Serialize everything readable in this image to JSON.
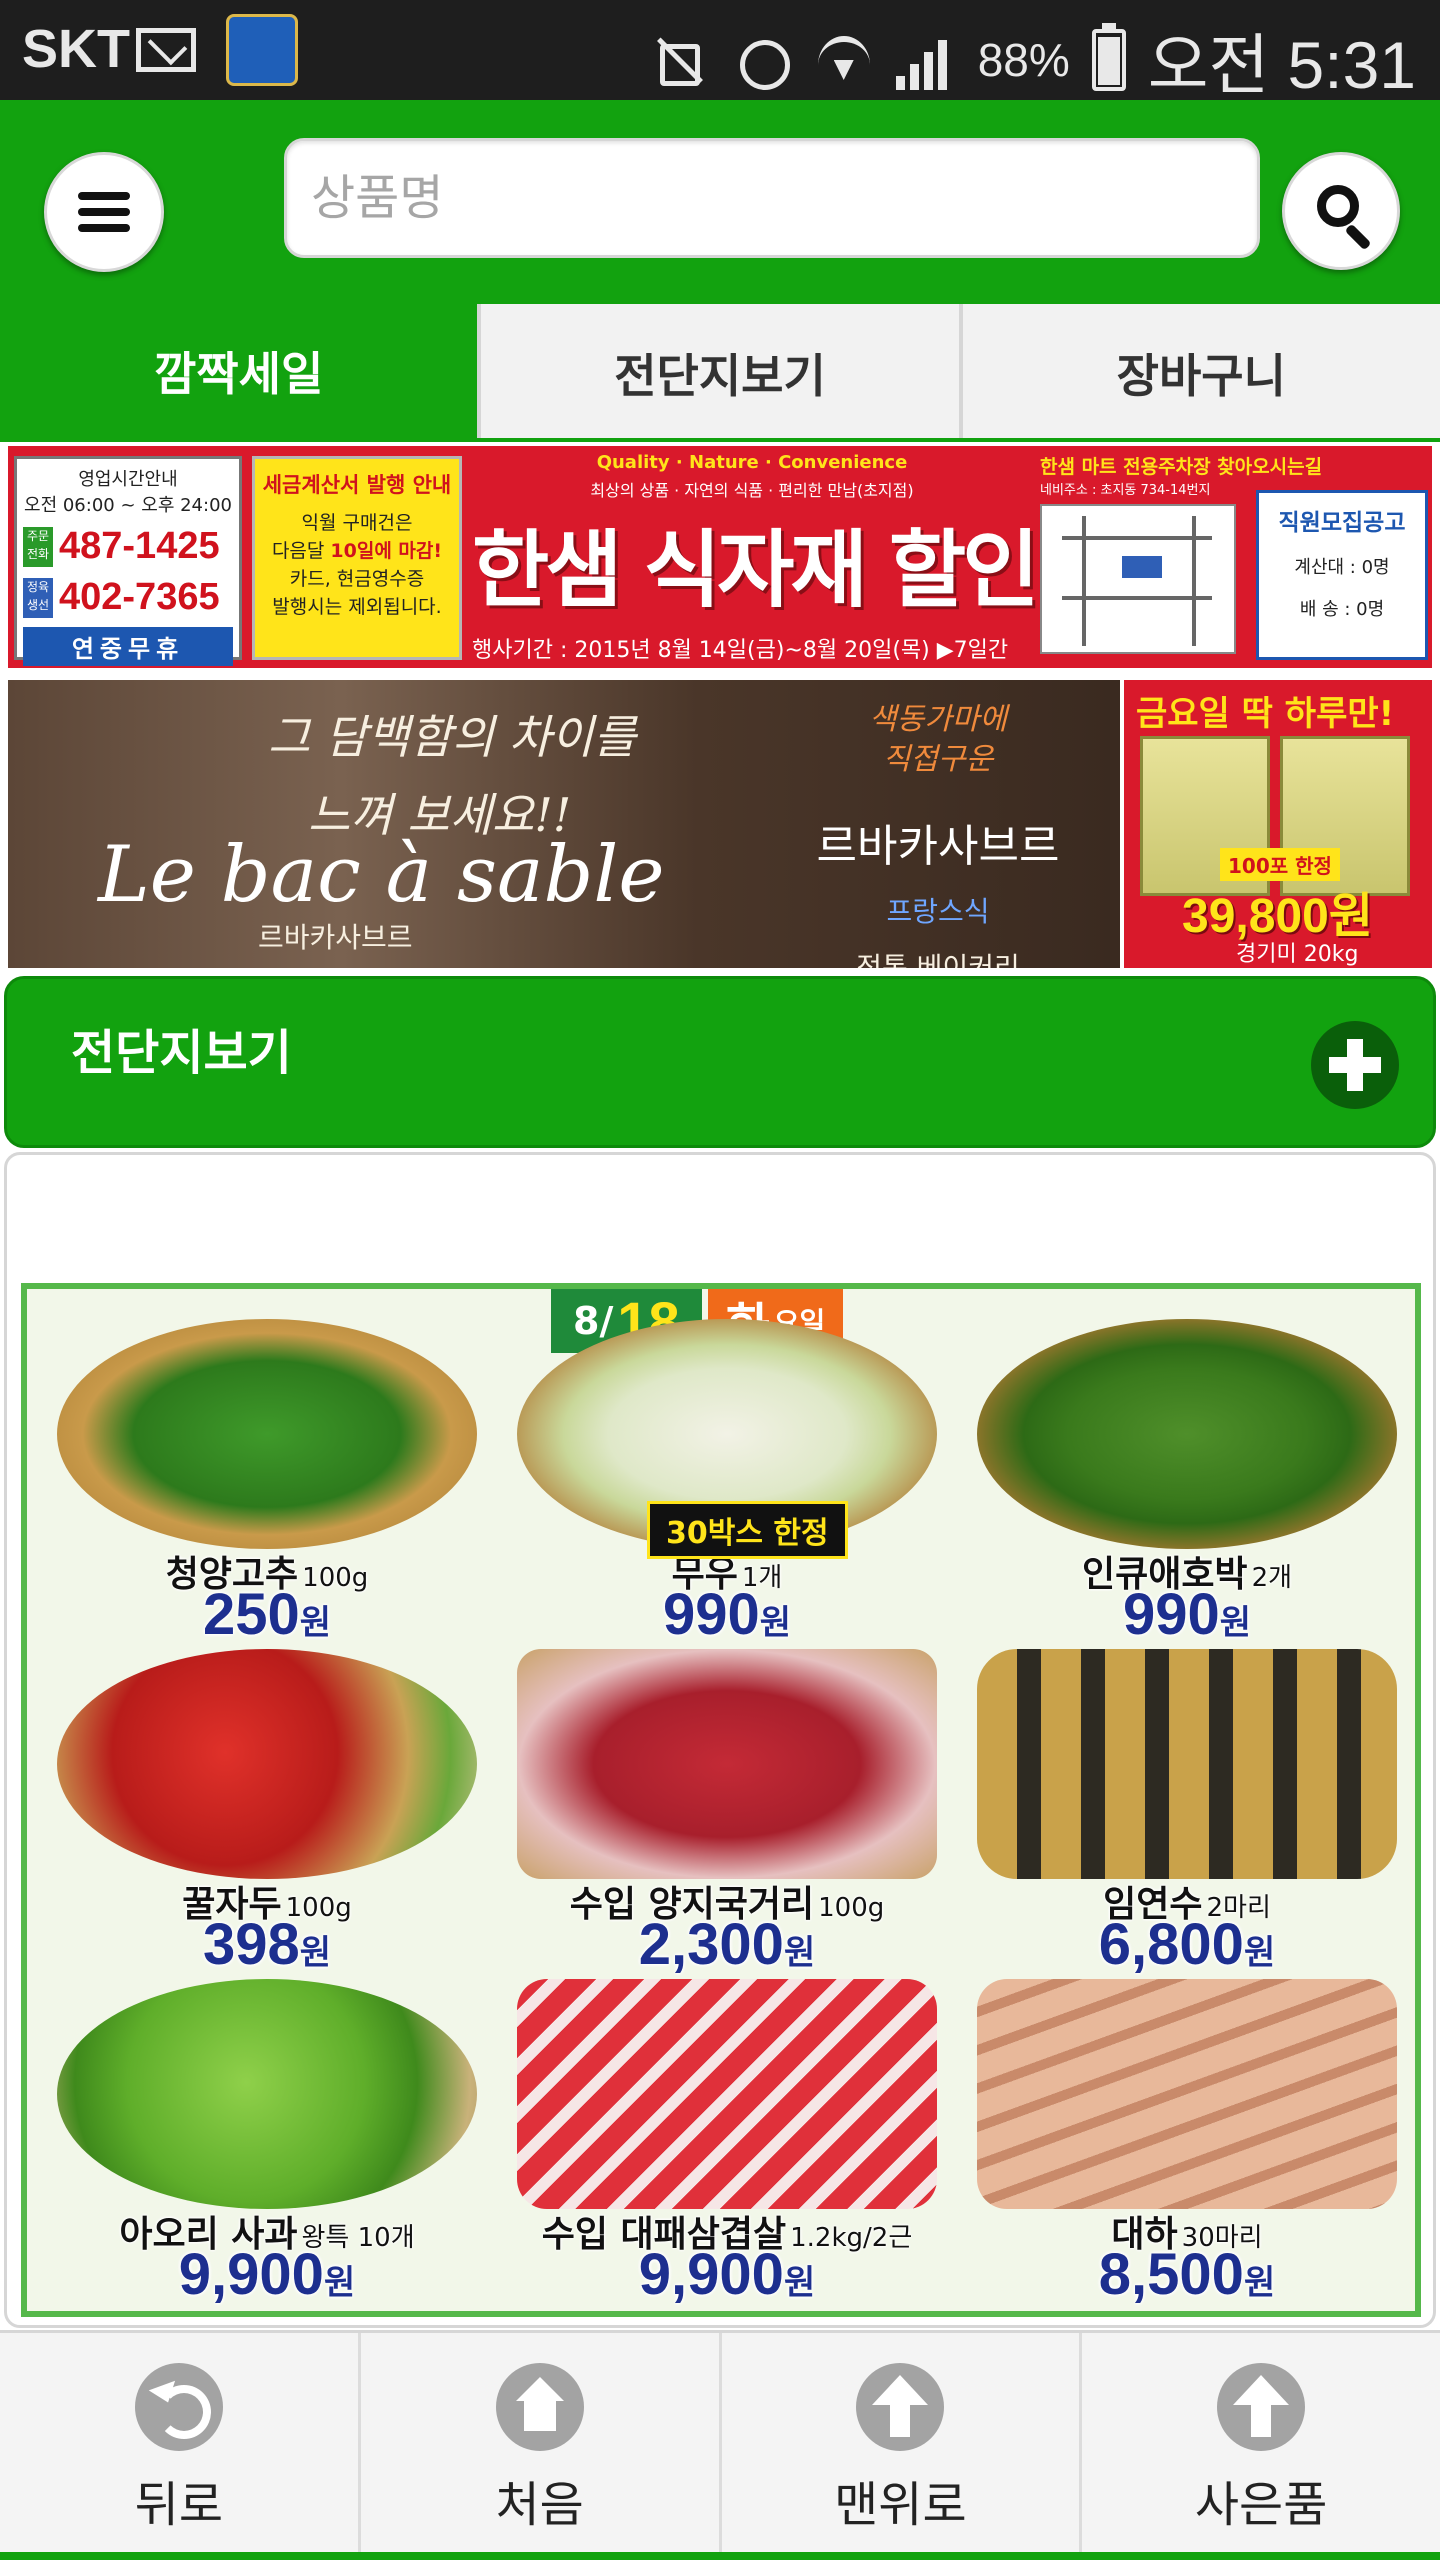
{
  "status_bar": {
    "carrier": "SKT",
    "battery_percent": "88%",
    "battery_level": 0.88,
    "time": "오전 5:31",
    "icons": [
      "mail-icon",
      "app-icon",
      "mute-icon",
      "alarm-icon",
      "wifi-icon",
      "signal-icon",
      "battery-icon"
    ]
  },
  "header": {
    "search_placeholder": "상품명",
    "menu_icon": "hamburger-icon",
    "search_icon": "search-icon",
    "accent_color": "#12a20f"
  },
  "tabs": [
    {
      "label": "깜짝세일",
      "active": true
    },
    {
      "label": "전단지보기",
      "active": false
    },
    {
      "label": "장바구니",
      "active": false
    }
  ],
  "banner_store": {
    "hours_title": "영업시간안내",
    "hours": "오전 06:00 ~ 오후 24:00",
    "tag_main": "주문전화",
    "phone_main": "487-1425",
    "tag_meat": "정육생선",
    "phone_meat": "402-7365",
    "open_all_year": "연중무휴",
    "notice_title": "세금계산서 발행 안내",
    "notice_line1": "익월 구매건은",
    "notice_line2_prefix": "다음달 ",
    "notice_line2_highlight": "10일에 마감!",
    "notice_line3": "카드, 현금영수증",
    "notice_line4": "발행시는 제외됩니다.",
    "quality_line": "Quality · Nature · Convenience",
    "slogan": "최상의 상품 · 자연의 식품 · 편리한 만남(초지점)",
    "store_name": "한샘 식자재 할인마트",
    "period": "행사기간 : 2015년 8월 14일(금)~8월 20일(목) ▶7일간",
    "parking_title": "한샘 마트 전용주차장 찾아오시는길",
    "address": "네비주소 : 초지동 734-14번지",
    "recruit_title": "직원모집공고",
    "recruit_line1": "계산대 : 0명",
    "recruit_line2": "배  송 : 0명"
  },
  "banner_bakery": {
    "slogan_line1": "그 담백함의 차이를",
    "slogan_line2": "느껴 보세요!!",
    "brand": "Le bac à sable",
    "brand_kr": "르바카사브르",
    "handwriting_line1": "색동가마에",
    "handwriting_line2": "직접구운",
    "right_brand": "르바카사브르",
    "french": "프랑스식",
    "tradition": "정통 베이커리"
  },
  "banner_rice": {
    "title": "금요일 딱 하루만!",
    "limited": "100포 한정",
    "price": "39,800원",
    "product": "경기미 20kg"
  },
  "flyer_section": {
    "title": "전단지보기",
    "expand_icon": "plus-icon"
  },
  "flyer": {
    "date_prefix": "8/",
    "date_day": "18",
    "weekday": "화",
    "weekday_suffix": "요일",
    "limit_tag": "30박스 한정",
    "products": [
      {
        "name": "청양고추",
        "unit": "100g",
        "price": "250",
        "currency": "원"
      },
      {
        "name": "무우",
        "unit": "1개",
        "price": "990",
        "currency": "원"
      },
      {
        "name": "인큐애호박",
        "unit": "2개",
        "price": "990",
        "currency": "원"
      },
      {
        "name": "꿀자두",
        "unit": "100g",
        "price": "398",
        "currency": "원"
      },
      {
        "name": "수입 양지국거리",
        "unit": "100g",
        "price": "2,300",
        "currency": "원"
      },
      {
        "name": "임연수",
        "unit": "2마리",
        "price": "6,800",
        "currency": "원"
      },
      {
        "name": "아오리 사과",
        "unit": "왕특 10개",
        "price": "9,900",
        "currency": "원"
      },
      {
        "name": "수입 대패삼겹살",
        "unit": "1.2kg/2근",
        "price": "9,900",
        "currency": "원"
      },
      {
        "name": "대하",
        "unit": "30마리",
        "price": "8,500",
        "currency": "원"
      }
    ]
  },
  "bottom_nav": [
    {
      "label": "뒤로",
      "icon": "back-icon"
    },
    {
      "label": "처음",
      "icon": "home-icon"
    },
    {
      "label": "맨위로",
      "icon": "arrow-up-icon"
    },
    {
      "label": "사은품",
      "icon": "arrow-up-icon"
    }
  ]
}
